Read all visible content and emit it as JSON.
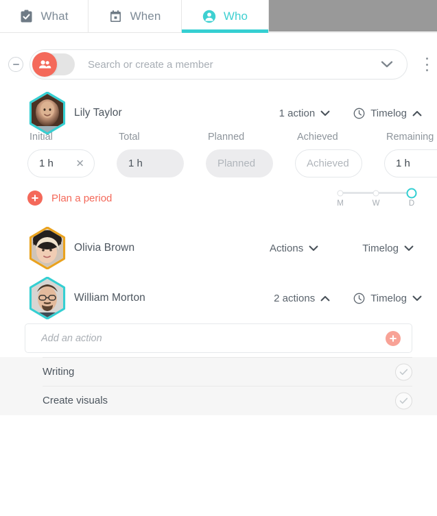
{
  "tabs": [
    {
      "label": "What",
      "icon": "clipboard-check-icon",
      "active": false
    },
    {
      "label": "When",
      "icon": "calendar-icon",
      "active": false
    },
    {
      "label": "Who",
      "icon": "person-icon",
      "active": true
    }
  ],
  "colors": {
    "accent_teal": "#35cfd2",
    "accent_coral": "#f4695a",
    "accent_coral_light": "#f8a296",
    "gray_block": "#999999",
    "avatar_border_teal": "#35cfd2",
    "avatar_border_orange": "#e9a21f",
    "text_primary": "#4c555e",
    "text_muted": "#8d949b",
    "list_bg": "#f6f6f6"
  },
  "search": {
    "placeholder": "Search or create a member",
    "value": "",
    "toggle_icon": "people-icon",
    "toggle_on": false,
    "dropdown_icon": "chevron-down-icon",
    "collapse_icon": "minus-circle-icon",
    "overflow_icon": "kebab-menu-icon"
  },
  "members": [
    {
      "name": "Lily Taylor",
      "avatar_border": "teal",
      "actions_label": "1 action",
      "actions_chevron": "chevron-down-icon",
      "timelog_label": "Timelog",
      "timelog_icon": "clock-icon",
      "timelog_chevron": "chevron-up-icon",
      "expanded": true
    },
    {
      "name": "Olivia Brown",
      "avatar_border": "orange",
      "actions_label": "Actions",
      "actions_chevron": "chevron-down-icon",
      "timelog_label": "Timelog",
      "timelog_icon": null,
      "timelog_chevron": "chevron-down-icon",
      "expanded": false
    },
    {
      "name": "William Morton",
      "avatar_border": "teal",
      "actions_label": "2 actions",
      "actions_chevron": "chevron-up-icon",
      "timelog_label": "Timelog",
      "timelog_icon": "clock-icon",
      "timelog_chevron": "chevron-down-icon",
      "expanded": true
    }
  ],
  "timelog": {
    "fields": [
      {
        "label": "Initial",
        "value": "1 h",
        "placeholder": "",
        "style": "outline",
        "clearable": true
      },
      {
        "label": "Total",
        "value": "1 h",
        "placeholder": "",
        "style": "filled",
        "clearable": false
      },
      {
        "label": "Planned",
        "value": "",
        "placeholder": "Planned",
        "style": "filled",
        "clearable": false
      },
      {
        "label": "Achieved",
        "value": "",
        "placeholder": "Achieved",
        "style": "outline",
        "clearable": false
      },
      {
        "label": "Remaining",
        "value": "1 h",
        "placeholder": "",
        "style": "outline",
        "clearable": false
      }
    ],
    "plan_period_label": "Plan a period",
    "plan_period_icon": "plus-circle-icon",
    "clear_icon": "close-x-icon",
    "scale": {
      "options": [
        "M",
        "W",
        "D"
      ],
      "selected_index": 2
    }
  },
  "add_action": {
    "placeholder": "Add an action",
    "value": "",
    "add_icon": "plus-circle-icon"
  },
  "action_items": [
    {
      "text": "Writing",
      "done_icon": "check-icon",
      "done": false
    },
    {
      "text": "Create visuals",
      "done_icon": "check-icon",
      "done": false
    }
  ]
}
